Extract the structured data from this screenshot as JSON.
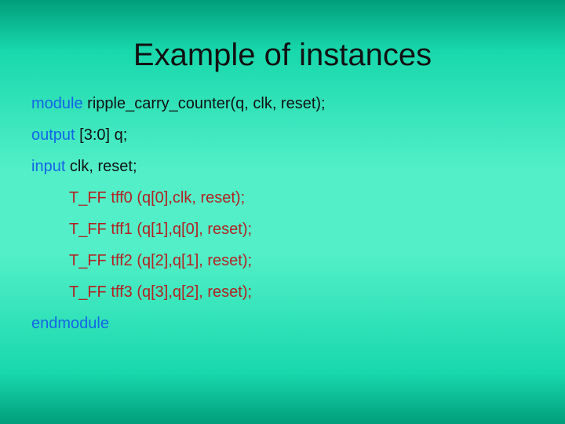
{
  "title": "Example of instances",
  "code": {
    "l1": {
      "kw": "module",
      "rest": " ripple_carry_counter(q, clk, reset);"
    },
    "l2": {
      "kw": "output",
      "rest": " [3:0] q;"
    },
    "l3": {
      "kw": "input",
      "rest": " clk, reset;"
    },
    "l4": "T_FF tff0 (q[0],clk, reset);",
    "l5": "T_FF tff1 (q[1],q[0], reset);",
    "l6": "T_FF tff2 (q[2],q[1], reset);",
    "l7": "T_FF tff3 (q[3],q[2], reset);",
    "l8": "endmodule"
  }
}
